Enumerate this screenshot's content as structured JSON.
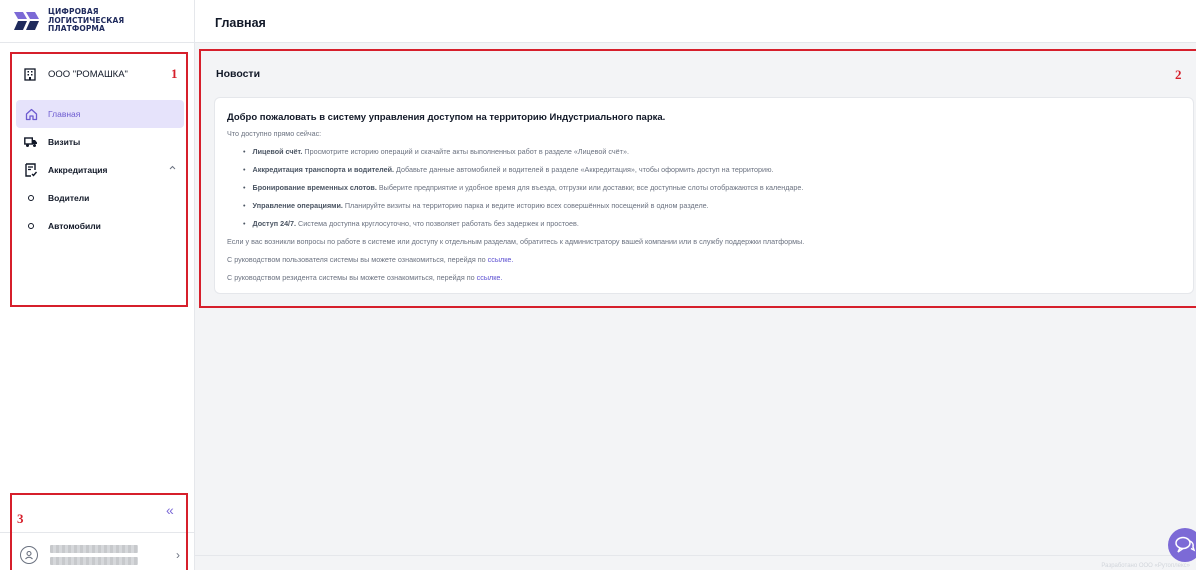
{
  "logo": {
    "lines": [
      "ЦИФРОВАЯ",
      "ЛОГИСТИЧЕСКАЯ",
      "ПЛАТФОРМА"
    ]
  },
  "sidebar": {
    "org_name": "ООО \"РОМАШКА\"",
    "items": [
      {
        "label": "Главная",
        "icon": "home-icon",
        "active": true
      },
      {
        "label": "Визиты",
        "icon": "truck-icon"
      },
      {
        "label": "Аккредитация",
        "icon": "document-check-icon",
        "expanded": true
      }
    ],
    "subitems": [
      {
        "label": "Водители"
      },
      {
        "label": "Автомобили"
      }
    ],
    "collapse_icon": "«",
    "user_chevron": "›"
  },
  "header": {
    "title": "Главная"
  },
  "news": {
    "title": "Новости",
    "heading": "Добро пожаловать в систему управления доступом на территорию Индустриального парка.",
    "intro": "Что доступно прямо сейчас:",
    "bullets": [
      {
        "bold": "Лицевой счёт.",
        "text": " Просмотрите историю операций и скачайте акты выполненных работ в разделе «Лицевой счёт»."
      },
      {
        "bold": "Аккредитация транспорта и водителей.",
        "text": " Добавьте данные автомобилей и водителей в разделе «Аккредитация», чтобы оформить доступ на территорию."
      },
      {
        "bold": "Бронирование временных слотов.",
        "text": " Выберите предприятие и удобное время для въезда, отгрузки или доставки; все доступные слоты отображаются в календаре."
      },
      {
        "bold": "Управление операциями.",
        "text": " Планируйте визиты на территорию парка и ведите историю всех совершённых посещений в одном разделе."
      },
      {
        "bold": "Доступ 24/7.",
        "text": " Система доступна круглосуточно, что позволяет работать без задержек и простоев."
      }
    ],
    "support": "Если у вас возникли вопросы по работе в системе или доступу к отдельным разделам, обратитесь к администратору вашей компании или в службу поддержки платформы.",
    "guide_user_text": "С руководством пользователя системы вы можете ознакомиться, перейдя по ",
    "guide_user_link": "ссылке.",
    "guide_resident_text": "С руководством резидента системы вы можете ознакомиться, перейдя по ",
    "guide_resident_link": "ссылке."
  },
  "annotations": [
    "1",
    "2",
    "3"
  ],
  "footer": {
    "developer": "Разработано ООО «Рутоплекс»"
  },
  "colors": {
    "accent": "#7c6ad6",
    "active_bg": "#e6e3fb",
    "annotation": "#d61f2b",
    "link": "#5b4fd1"
  }
}
